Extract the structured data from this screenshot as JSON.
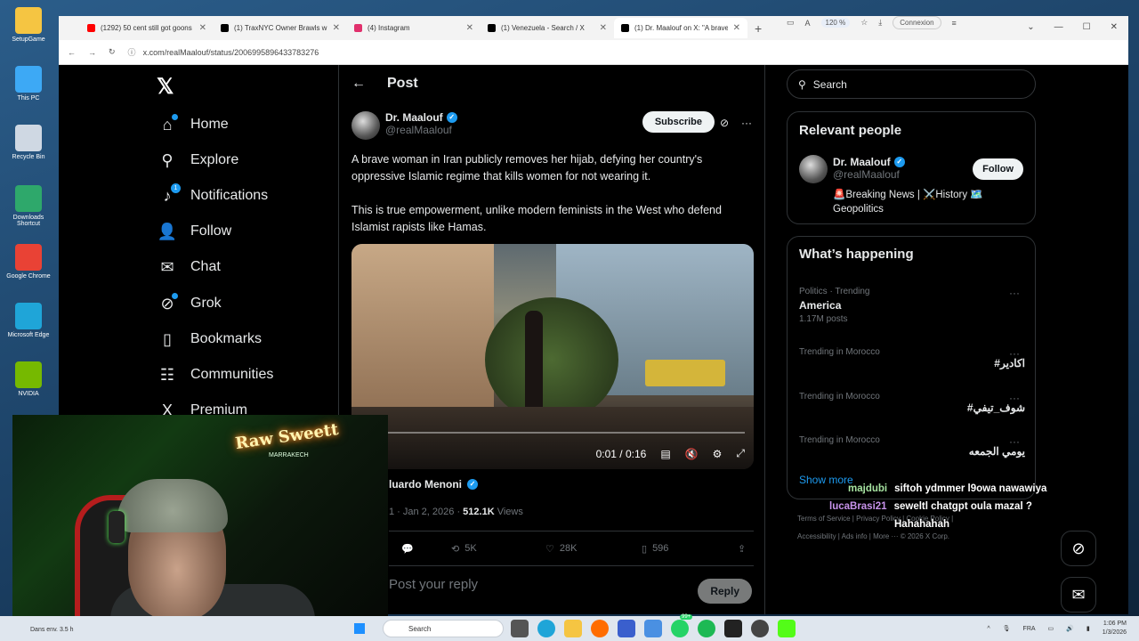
{
  "desktop": {
    "icons": [
      {
        "label": "SetupGame",
        "icon": "folder-icon",
        "color": "#f5c542"
      },
      {
        "label": "This PC",
        "icon": "monitor-icon",
        "color": "#3da9f5"
      },
      {
        "label": "Recycle Bin",
        "icon": "recycle-bin-icon",
        "color": "#cfd8e3"
      },
      {
        "label": "Downloads Shortcut",
        "icon": "download-folder-icon",
        "color": "#2ea86b"
      },
      {
        "label": "Google Chrome",
        "icon": "chrome-icon",
        "color": "#e94235"
      },
      {
        "label": "Microsoft Edge",
        "icon": "edge-icon",
        "color": "#1fa5d8"
      },
      {
        "label": "NVIDIA",
        "icon": "nvidia-icon",
        "color": "#76b900"
      }
    ]
  },
  "browser": {
    "tabs": [
      {
        "label": "(1292) 50 cent still got goons in",
        "favicon_color": "#ff0000",
        "active": false
      },
      {
        "label": "(1) TraxNYC Owner Brawls with",
        "favicon_color": "#000000",
        "active": false
      },
      {
        "label": "(4) Instagram",
        "favicon_color": "#e1306c",
        "active": false
      },
      {
        "label": "(1) Venezuela - Search / X",
        "favicon_color": "#000000",
        "active": false
      },
      {
        "label": "(1) Dr. Maalouf on X: \"A brave",
        "favicon_color": "#000000",
        "active": true
      }
    ],
    "url": "x.com/realMaalouf/status/2006995896433783276",
    "zoom": "120 %",
    "connexion_label": "Connexion"
  },
  "nav": {
    "items": [
      {
        "label": "Home",
        "icon": "home-icon",
        "glyph": "⌂",
        "dot": true
      },
      {
        "label": "Explore",
        "icon": "search-icon",
        "glyph": "⚲"
      },
      {
        "label": "Notifications",
        "icon": "bell-icon",
        "glyph": "♪",
        "badge": "1"
      },
      {
        "label": "Follow",
        "icon": "person-add-icon",
        "glyph": "👤"
      },
      {
        "label": "Chat",
        "icon": "mail-icon",
        "glyph": "✉"
      },
      {
        "label": "Grok",
        "icon": "grok-icon",
        "glyph": "⊘",
        "dot": true
      },
      {
        "label": "Bookmarks",
        "icon": "bookmark-icon",
        "glyph": "▯"
      },
      {
        "label": "Communities",
        "icon": "communities-icon",
        "glyph": "☷"
      },
      {
        "label": "Premium",
        "icon": "x-premium-icon",
        "glyph": "X"
      }
    ]
  },
  "post": {
    "header": "Post",
    "author_name": "Dr. Maalouf",
    "author_handle": "@realMaalouf",
    "subscribe_label": "Subscribe",
    "paragraph1": "A brave woman in Iran publicly removes her hijab, defying her country's oppressive Islamic regime that kills women for not wearing it.",
    "paragraph2": "This is true empowerment, unlike modern feminists in the West who defend Islamist rapists like Hamas.",
    "video_time": "0:01 / 0:16",
    "video_progress": 0.06,
    "quoted_author": "luardo Menoni",
    "meta_date": "1 · Jan 2, 2026 · ",
    "meta_views_count": "512.1K",
    "meta_views_label": " Views",
    "stats": {
      "reposts": "5K",
      "likes": "28K",
      "bookmarks": "596"
    },
    "reply_placeholder": "Post your reply",
    "reply_button": "Reply"
  },
  "sidebar": {
    "search_placeholder": "Search",
    "relevant_title": "Relevant people",
    "person_name": "Dr. Maalouf",
    "person_handle": "@realMaalouf",
    "follow_label": "Follow",
    "bio": "🚨Breaking News | ⚔️History 🗺️Geopolitics",
    "happening_title": "What’s happening",
    "trends": [
      {
        "category": "Politics · Trending",
        "name": "America",
        "count": "1.17M posts",
        "rtl": false
      },
      {
        "category": "Trending in Morocco",
        "name": "#اكادير",
        "count": "",
        "rtl": true
      },
      {
        "category": "Trending in Morocco",
        "name": "#شوف_تيفي",
        "count": "",
        "rtl": true
      },
      {
        "category": "Trending in Morocco",
        "name": "يومي الجمعه",
        "count": "",
        "rtl": true
      }
    ],
    "show_more": "Show more",
    "footer_line1": "Terms of Service  |  Privacy Policy  |  Cookie Policy  |",
    "footer_line2": "Accessibility  |  Ads info  |  More ···  © 2026 X Corp."
  },
  "chat": [
    {
      "user": "majdubi",
      "message": "siftoh ydmmer l9owa nawawiya",
      "color": "#a6e3a1"
    },
    {
      "user": "lucaBrasi21",
      "message": "seweltl chatgpt oula mazal ?",
      "color": "#c792ea"
    },
    {
      "user": "",
      "message": "Hahahahah",
      "color": "#ffffff"
    }
  ],
  "webcam": {
    "neon_text": "Raw Sweett",
    "neon_sub": "MARRAKECH"
  },
  "taskbar": {
    "weather": "Dans env. 3.5 h",
    "search_placeholder": "Search",
    "badge": "99+",
    "language": "FRA",
    "time": "1:06 PM",
    "date": "1/3/2026"
  }
}
